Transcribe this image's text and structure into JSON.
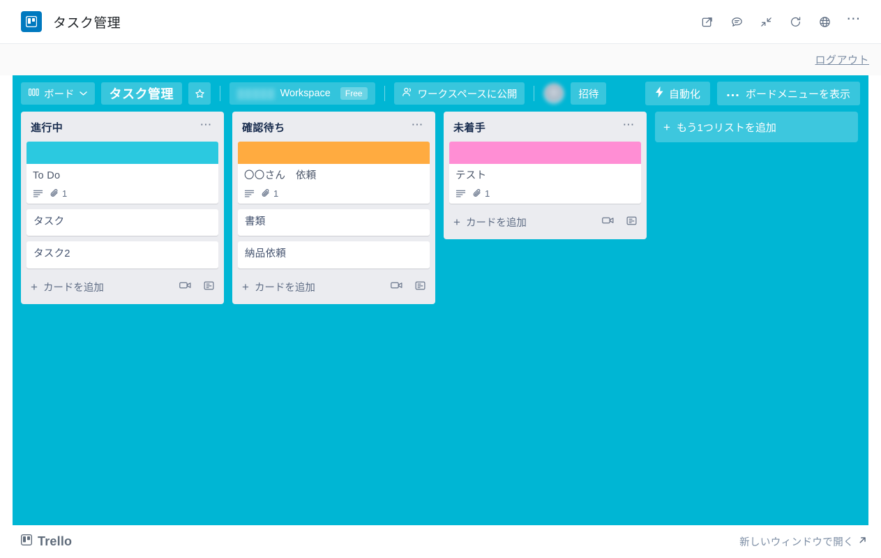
{
  "header": {
    "title": "タスク管理",
    "logo_icon": "trello-board-icon",
    "icons": [
      {
        "name": "open-in-new-icon"
      },
      {
        "name": "comment-icon"
      },
      {
        "name": "collapse-icon"
      },
      {
        "name": "refresh-icon"
      },
      {
        "name": "globe-icon"
      },
      {
        "name": "more-options-icon"
      }
    ]
  },
  "logout": {
    "label": "ログアウト"
  },
  "board_bar": {
    "boards_button": "ボード",
    "board_title": "タスク管理",
    "star_icon": "star-icon",
    "workspace_name_blurred": "▒▒▒▒▒",
    "workspace_label": "Workspace",
    "plan_badge": "Free",
    "visibility_label": "ワークスペースに公開",
    "invite_label": "招待",
    "automation_label": "自動化",
    "board_menu_label": "ボードメニューを表示"
  },
  "board": {
    "background_color": "#00b6d4",
    "add_list_label": "もう1つリストを追加",
    "lists": [
      {
        "title": "進行中",
        "cards": [
          {
            "title": "To Do",
            "cover_color": "#2BC9E0",
            "has_description": true,
            "attachment_count": "1"
          },
          {
            "title": "タスク",
            "cover_color": null
          },
          {
            "title": "タスク2",
            "cover_color": null
          }
        ],
        "add_card_label": "カードを追加"
      },
      {
        "title": "確認待ち",
        "cards": [
          {
            "title": "〇〇さん　依頼",
            "cover_color": "#FFAB40",
            "has_description": true,
            "attachment_count": "1"
          },
          {
            "title": "書類",
            "cover_color": null
          },
          {
            "title": "納品依頼",
            "cover_color": null
          }
        ],
        "add_card_label": "カードを追加"
      },
      {
        "title": "未着手",
        "cards": [
          {
            "title": "テスト",
            "cover_color": "#FF8ED4",
            "has_description": true,
            "attachment_count": "1"
          }
        ],
        "add_card_label": "カードを追加"
      }
    ]
  },
  "footer": {
    "brand": "Trello",
    "open_new_window": "新しいウィンドウで開く"
  }
}
